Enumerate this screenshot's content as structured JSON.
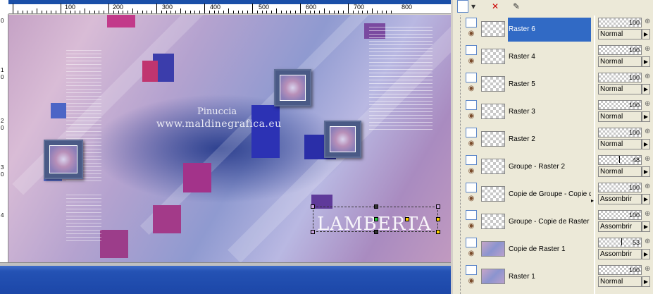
{
  "ruler": {
    "top_labels": [
      "100",
      "200",
      "300",
      "400",
      "500",
      "600",
      "700",
      "800"
    ],
    "left_labels": [
      "0",
      "1",
      "0",
      "2",
      "0",
      "3",
      "0",
      "4"
    ]
  },
  "canvas": {
    "watermark_line1": "Pinuccia",
    "watermark_line2": "www.maldinegrafica.eu",
    "signature_text": "LAMBERTA"
  },
  "toolbar": {
    "layer_dropdown_icon": "layer-icon",
    "delete_icon": "delete-layer-icon",
    "mask_icon": "mask-icon"
  },
  "layers": [
    {
      "name": "Raster 6",
      "opacity": "100",
      "blend": "Normal",
      "selected": true,
      "thumb": "checker"
    },
    {
      "name": "Raster 4",
      "opacity": "100",
      "blend": "Normal",
      "selected": false,
      "thumb": "checker"
    },
    {
      "name": "Raster 5",
      "opacity": "100",
      "blend": "Normal",
      "selected": false,
      "thumb": "checker"
    },
    {
      "name": "Raster 3",
      "opacity": "100",
      "blend": "Normal",
      "selected": false,
      "thumb": "checker"
    },
    {
      "name": "Raster 2",
      "opacity": "100",
      "blend": "Normal",
      "selected": false,
      "thumb": "checker"
    },
    {
      "name": "Groupe - Raster 2",
      "opacity": "48",
      "blend": "Normal",
      "selected": false,
      "thumb": "checker"
    },
    {
      "name": "Copie de Groupe - Copie de",
      "opacity": "100",
      "blend": "Assombrir",
      "selected": false,
      "thumb": "checker"
    },
    {
      "name": "Groupe - Copie de Raster 1",
      "opacity": "100",
      "blend": "Assombrir",
      "selected": false,
      "thumb": "checker"
    },
    {
      "name": "Copie de Raster 1",
      "opacity": "53",
      "blend": "Assombrir",
      "selected": false,
      "thumb": "img"
    },
    {
      "name": "Raster 1",
      "opacity": "100",
      "blend": "Normal",
      "selected": false,
      "thumb": "img"
    }
  ],
  "colors": {
    "selection": "#316ac5",
    "taskbar": "#2452b4",
    "panel": "#ece9d8"
  }
}
